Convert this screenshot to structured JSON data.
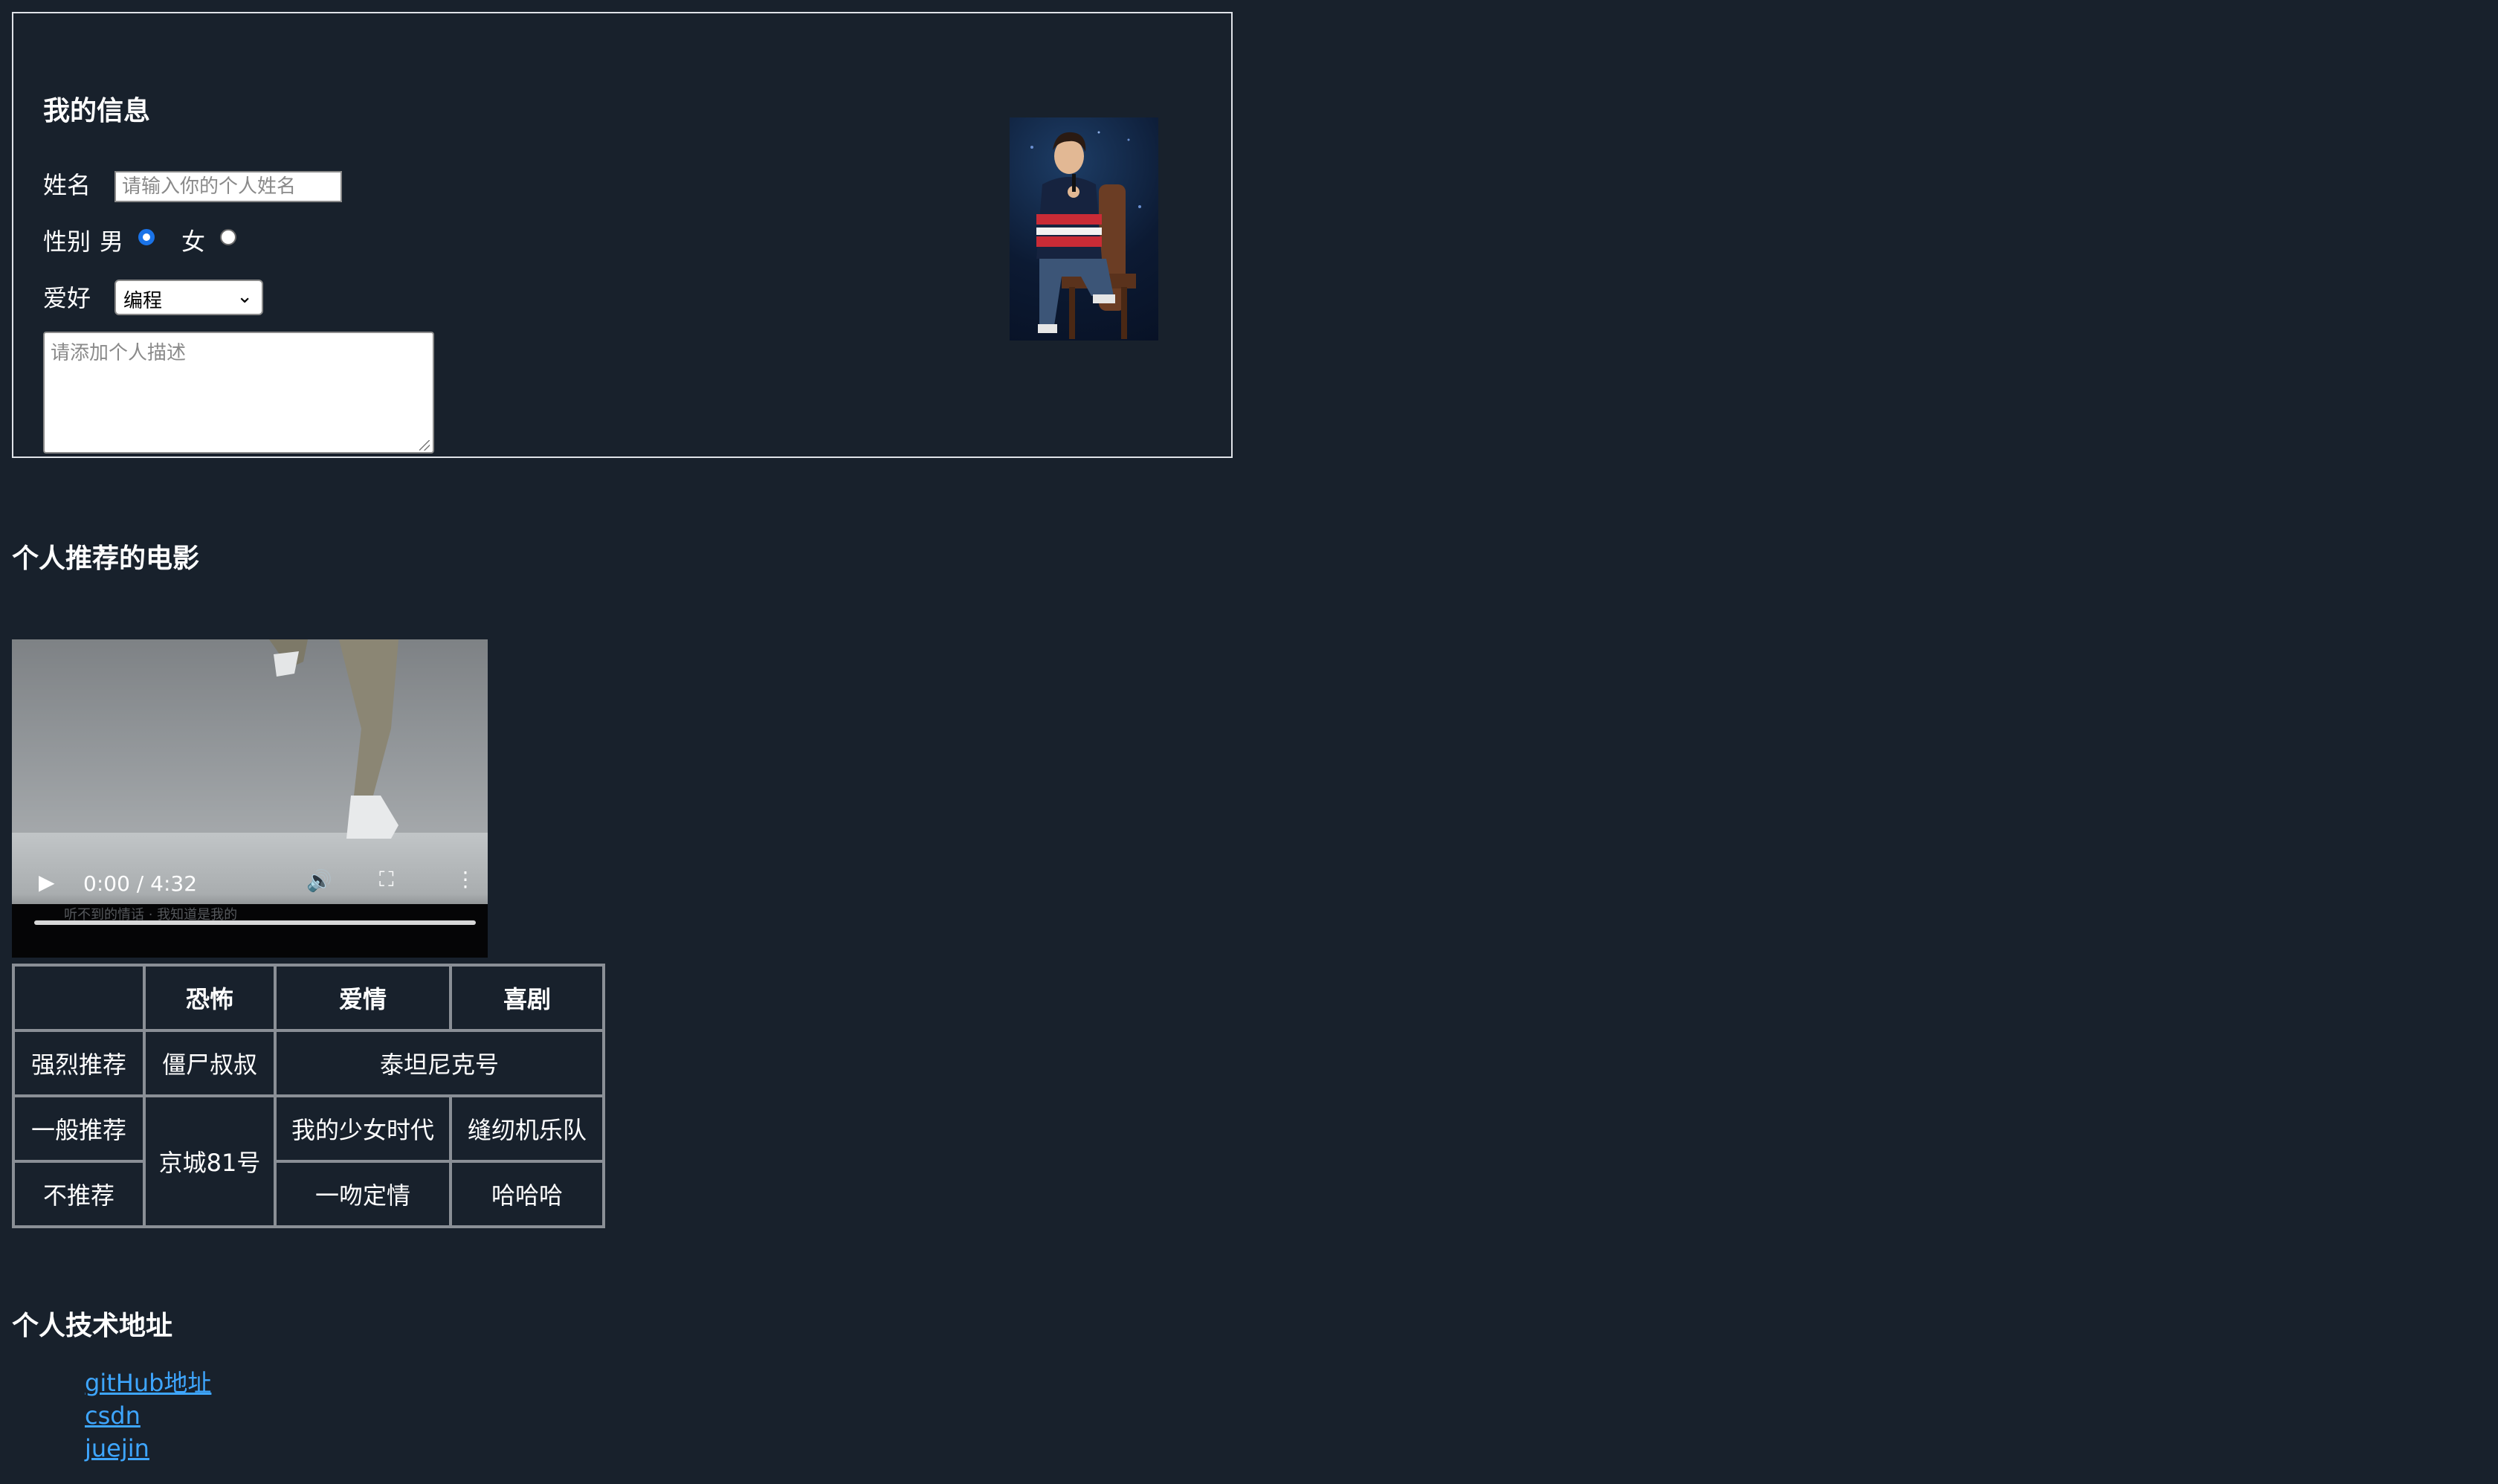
{
  "info": {
    "title": "我的信息",
    "name_label": "姓名",
    "name_placeholder": "请输入你的个人姓名",
    "gender_label": "性别",
    "gender_male": "男",
    "gender_female": "女",
    "gender_selected": "男",
    "hobby_label": "爱好",
    "hobby_selected": "编程",
    "description_placeholder": "请添加个人描述"
  },
  "movies": {
    "title": "个人推荐的电影",
    "video": {
      "current_time": "0:00",
      "separator": "/",
      "duration": "4:32",
      "subtitle_text": "听不到的情话 · 我知道是我的"
    },
    "table": {
      "headers": [
        "",
        "恐怖",
        "爱情",
        "喜剧"
      ],
      "rows": [
        {
          "label": "强烈推荐",
          "horror": "僵尸叔叔",
          "romance_comedy": "泰坦尼克号"
        },
        {
          "label": "一般推荐",
          "horror": "京城81号",
          "romance": "我的少女时代",
          "comedy": "缝纫机乐队"
        },
        {
          "label": "不推荐",
          "romance": "一吻定情",
          "comedy": "哈哈哈"
        }
      ]
    }
  },
  "tech": {
    "title": "个人技术地址",
    "links": [
      "gitHub地址",
      "csdn",
      "juejin"
    ]
  },
  "colors": {
    "background": "#18212c",
    "link": "#3ea6ff",
    "radio_checked": "#1a73e8"
  }
}
